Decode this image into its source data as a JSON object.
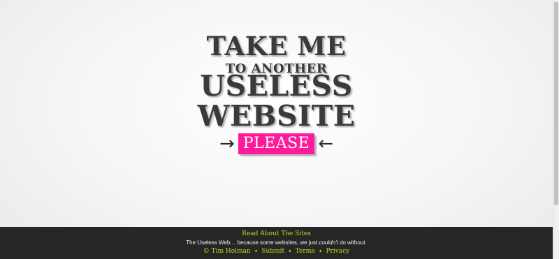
{
  "hero": {
    "line1": "TAKE ME",
    "line2": "TO ANOTHER",
    "line3": "USELESS",
    "line4": "WEBSITE",
    "button_label": "PLEASE",
    "arrow_left": "→",
    "arrow_right": "←"
  },
  "footer": {
    "read_about": "Read About The Sites",
    "tagline_prefix": "The Useless Web… because some websites, we just ",
    "tagline_emphasis": "couldn't",
    "tagline_suffix": " do without.",
    "copyright": "© Tim Holman",
    "separator": "✦",
    "submit": "Submit",
    "terms": "Terms",
    "privacy": "Privacy"
  },
  "colors": {
    "accent_pink": "#ff1a9b",
    "link_green": "#a9e21e",
    "footer_bg": "#262626",
    "headline_text": "#3a3a3a"
  }
}
